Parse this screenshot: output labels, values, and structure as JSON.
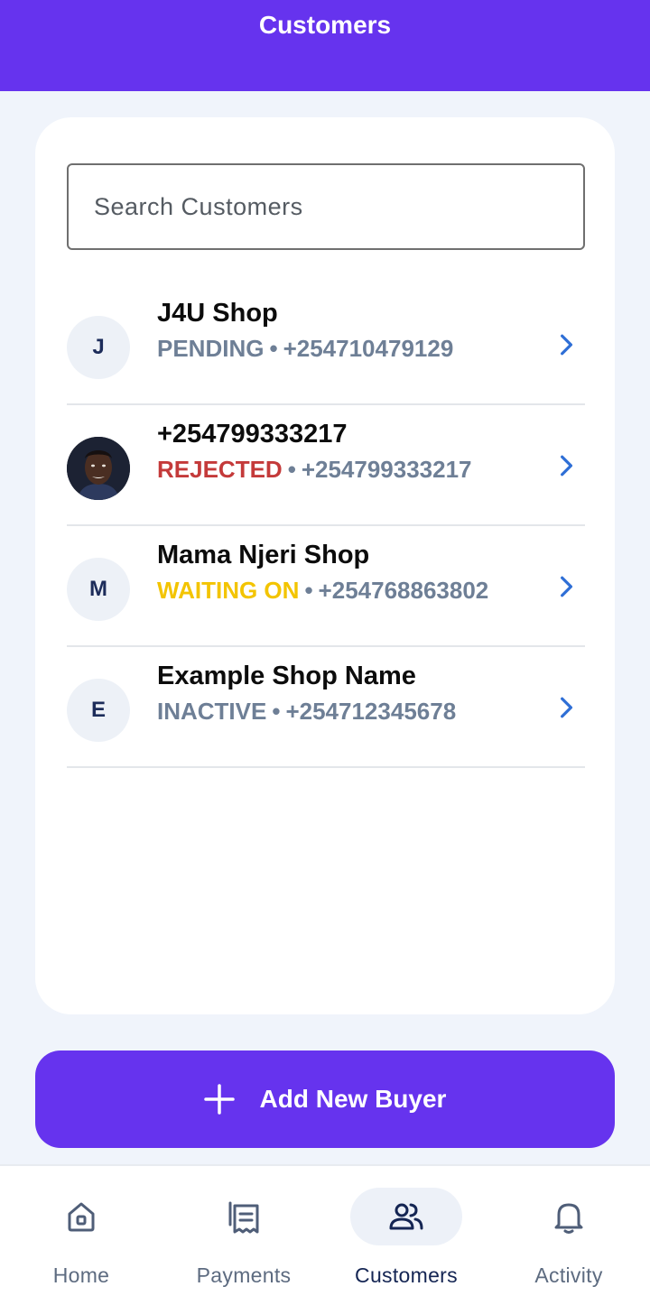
{
  "header": {
    "title": "Customers"
  },
  "search": {
    "placeholder": "Search Customers"
  },
  "customers": [
    {
      "initial": "J",
      "name": "J4U Shop",
      "status": "PENDING",
      "separator": "•",
      "phone": "+254710479129",
      "avatar": "initial"
    },
    {
      "initial": "",
      "name": "+254799333217",
      "status": "REJECTED",
      "separator": "•",
      "phone": "+254799333217",
      "avatar": "photo"
    },
    {
      "initial": "M",
      "name": "Mama Njeri Shop",
      "status": "WAITING ON",
      "separator": "•",
      "phone": "+254768863802",
      "avatar": "initial"
    },
    {
      "initial": "E",
      "name": "Example Shop Name",
      "status": "INACTIVE",
      "separator": "•",
      "phone": "+254712345678",
      "avatar": "initial"
    }
  ],
  "add_button": {
    "label": "Add New Buyer",
    "icon": "plus-icon"
  },
  "nav": {
    "items": [
      {
        "label": "Home",
        "icon": "home-icon",
        "active": false
      },
      {
        "label": "Payments",
        "icon": "receipt-icon",
        "active": false
      },
      {
        "label": "Customers",
        "icon": "users-icon",
        "active": true
      },
      {
        "label": "Activity",
        "icon": "bell-icon",
        "active": false
      }
    ]
  },
  "colors": {
    "brand": "#6633ee",
    "pending": "#6e7f96",
    "rejected": "#c43a3a",
    "waiting": "#f3c400",
    "chevron": "#2f6fd6",
    "nav_active": "#142553"
  }
}
